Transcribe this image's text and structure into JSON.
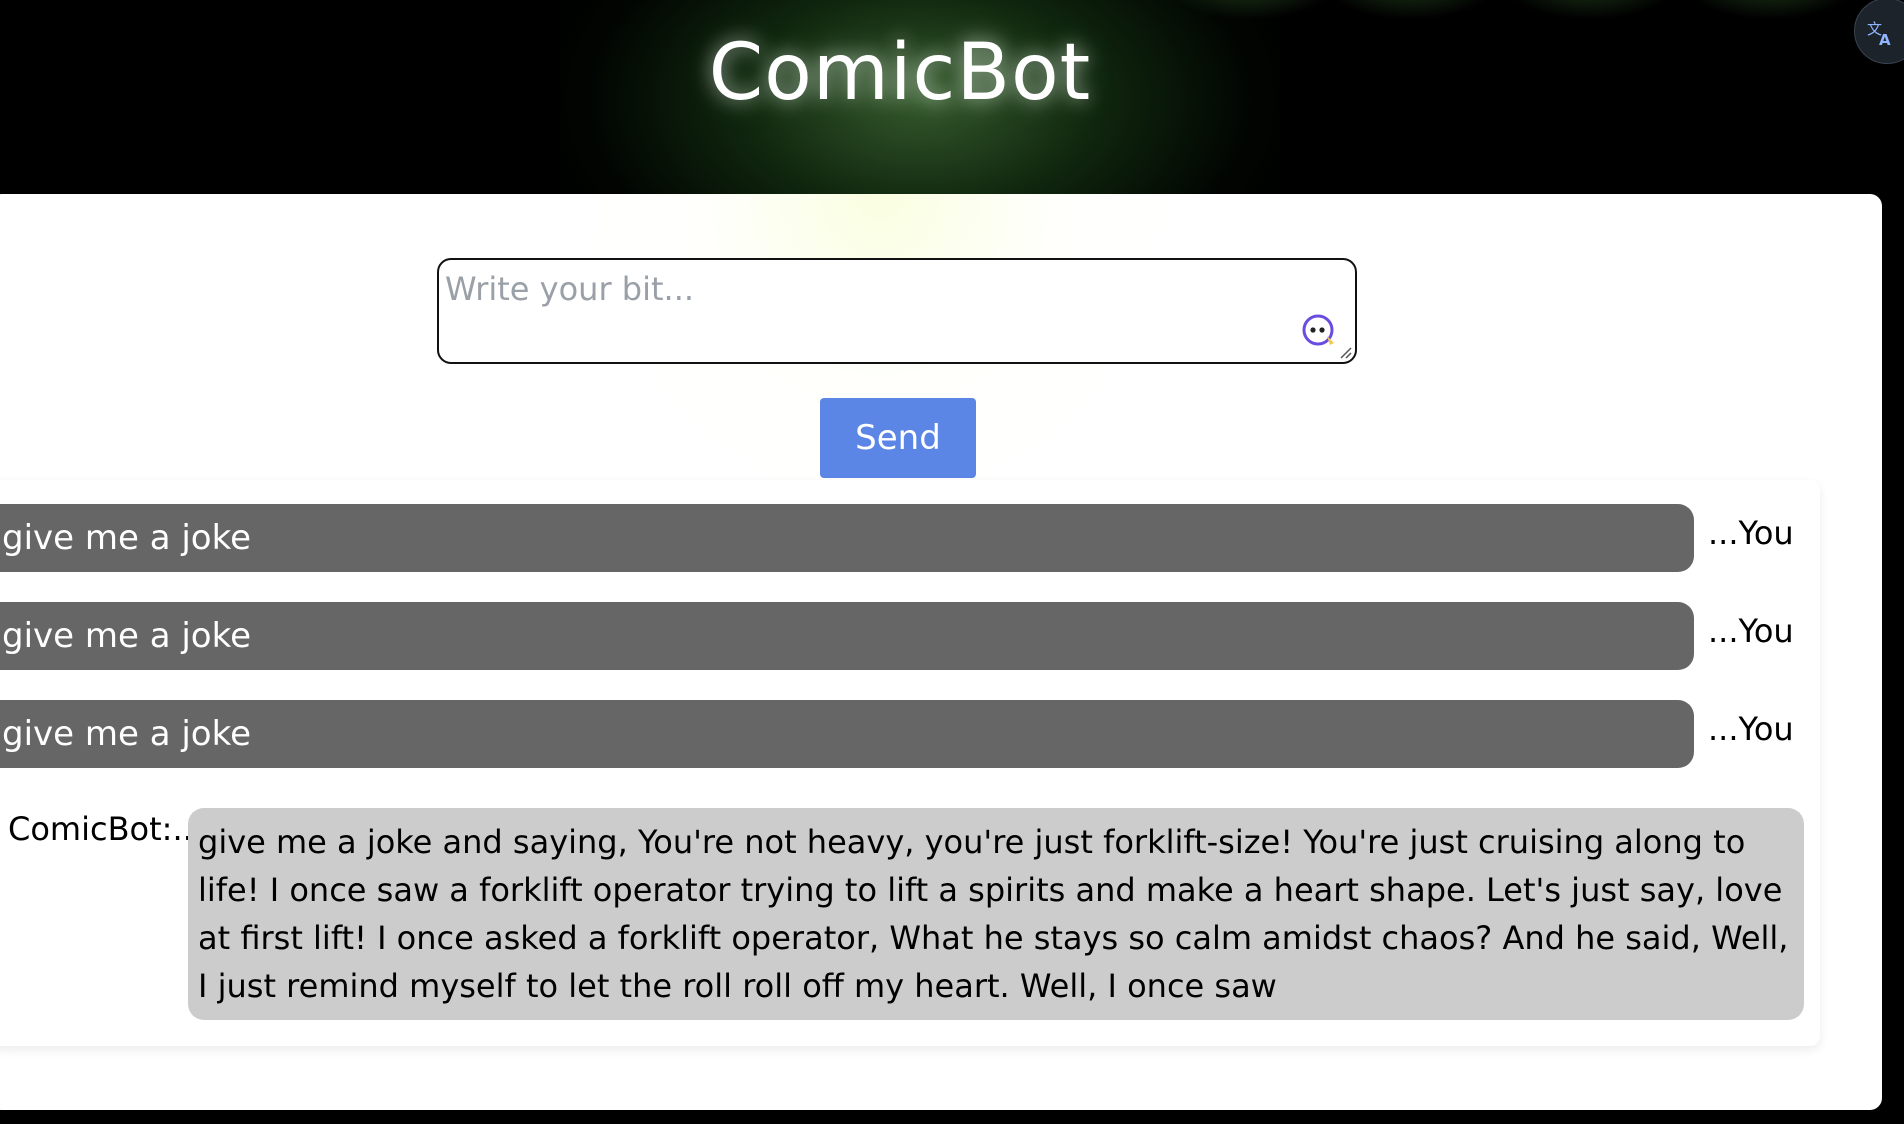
{
  "header": {
    "title": "ComicBot",
    "translate_icon": "translate-icon"
  },
  "composer": {
    "placeholder": "Write your bit...",
    "value": "",
    "assist_icon": "assistant-face-icon",
    "send_label": "Send"
  },
  "messages": {
    "user": [
      {
        "text": "give me a joke",
        "sender_label": "...You"
      },
      {
        "text": "give me a joke",
        "sender_label": "...You"
      },
      {
        "text": "give me a joke",
        "sender_label": "...You"
      }
    ],
    "bot": {
      "sender_label": "ComicBot:..",
      "text": "give me a joke and saying, You're not heavy, you're just forklift-size! You're just cruising along to life! I once saw a forklift operator trying to lift a spirits and make a heart shape. Let's just say, love at first lift! I once asked a forklift operator, What he stays so calm amidst chaos? And he said, Well, I just remind myself to let the roll roll off my heart. Well, I once saw"
    }
  },
  "colors": {
    "page_bg": "#000000",
    "card_bg": "#ffffff",
    "user_bubble": "#666666",
    "bot_bubble": "#cccccc",
    "send_button": "#5b86e5"
  }
}
